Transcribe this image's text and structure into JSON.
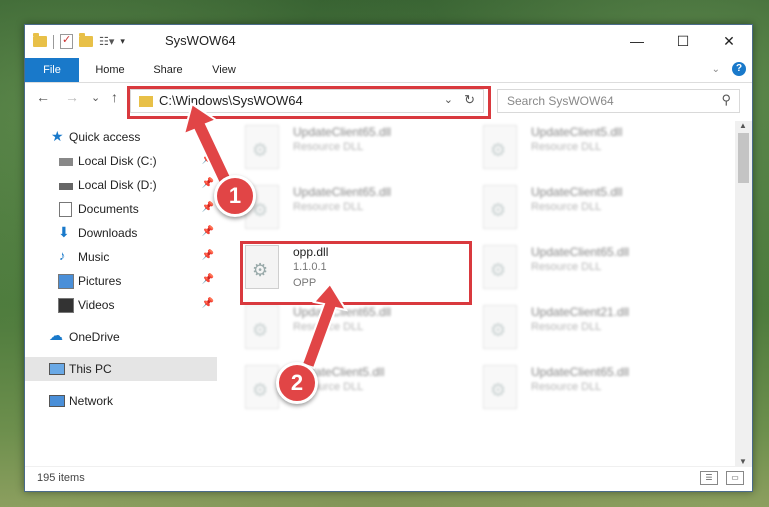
{
  "window": {
    "title": "SysWOW64",
    "controls": {
      "minimize": "—",
      "maximize": "☐",
      "close": "✕"
    }
  },
  "ribbon": {
    "tabs": [
      {
        "label": "File",
        "active": true
      },
      {
        "label": "Home"
      },
      {
        "label": "Share"
      },
      {
        "label": "View"
      }
    ],
    "help_label": "?"
  },
  "navigation": {
    "back": "←",
    "forward": "→",
    "recent": "⌄",
    "up": "↑",
    "address": "C:\\Windows\\SysWOW64",
    "refresh": "↻",
    "search_placeholder": "Search SysWOW64"
  },
  "sidebar": {
    "items": [
      {
        "label": "Quick access",
        "icon": "star-icon",
        "pinned": false
      },
      {
        "label": "Local Disk (C:)",
        "icon": "drive-icon",
        "pinned": true
      },
      {
        "label": "Local Disk (D:)",
        "icon": "drive-icon",
        "pinned": true
      },
      {
        "label": "Documents",
        "icon": "document-icon",
        "pinned": true
      },
      {
        "label": "Downloads",
        "icon": "download-icon",
        "pinned": true
      },
      {
        "label": "Music",
        "icon": "music-icon",
        "pinned": true
      },
      {
        "label": "Pictures",
        "icon": "picture-icon",
        "pinned": true
      },
      {
        "label": "Videos",
        "icon": "video-icon",
        "pinned": true
      },
      {
        "label": "OneDrive",
        "icon": "cloud-icon",
        "pinned": false
      },
      {
        "label": "This PC",
        "icon": "computer-icon",
        "pinned": false,
        "selected": true
      },
      {
        "label": "Network",
        "icon": "network-icon",
        "pinned": false
      }
    ],
    "pin_glyph": "📌"
  },
  "files": [
    {
      "name": "UpdateClient65.dll",
      "line1": "Resource DLL",
      "line2": ""
    },
    {
      "name": "UpdateClient5.dll",
      "line1": "Resource DLL",
      "line2": ""
    },
    {
      "name": "UpdateClient65.dll",
      "line1": "Resource DLL",
      "line2": ""
    },
    {
      "name": "UpdateClient5.dll",
      "line1": "Resource DLL",
      "line2": ""
    },
    {
      "name": "opp.dll",
      "line1": "1.1.0.1",
      "line2": "OPP",
      "highlighted": true
    },
    {
      "name": "UpdateClient65.dll",
      "line1": "Resource DLL",
      "line2": ""
    },
    {
      "name": "UpdateClient65.dll",
      "line1": "Resource DLL",
      "line2": ""
    },
    {
      "name": "UpdateClient21.dll",
      "line1": "Resource DLL",
      "line2": ""
    },
    {
      "name": "UpdateClient5.dll",
      "line1": "Resource DLL",
      "line2": ""
    },
    {
      "name": "UpdateClient65.dll",
      "line1": "Resource DLL",
      "line2": ""
    }
  ],
  "status": {
    "item_count": "195 items"
  },
  "annotations": {
    "step1": "1",
    "step2": "2",
    "color": "#e14546"
  }
}
